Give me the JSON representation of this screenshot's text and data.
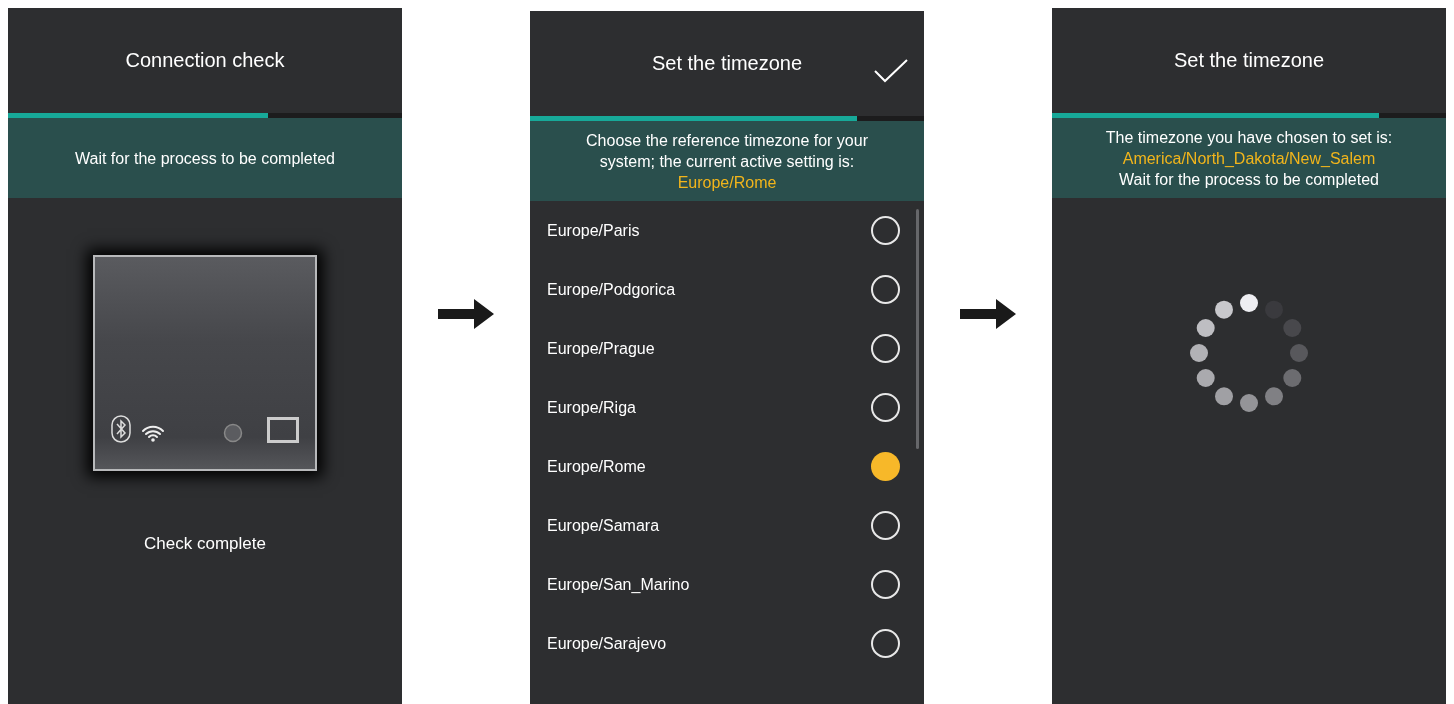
{
  "screens": [
    {
      "kind": "connection",
      "title": "Connection check",
      "confirm": false,
      "progress": {
        "level": 0.66
      },
      "banner": [
        [
          {
            "text": "Wait for the process to be completed",
            "highlight": false
          }
        ]
      ],
      "status": "Check complete"
    },
    {
      "kind": "list",
      "title": "Set the timezone",
      "confirm": true,
      "progress": {
        "level": 0.83
      },
      "banner": [
        [
          {
            "text": "Choose the reference timezone for your system; the current active setting is: ",
            "highlight": false
          },
          {
            "text": "Europe/Rome",
            "highlight": true
          }
        ]
      ],
      "timezones": [
        {
          "label": "Europe/Paris",
          "selected": false
        },
        {
          "label": "Europe/Podgorica",
          "selected": false
        },
        {
          "label": "Europe/Prague",
          "selected": false
        },
        {
          "label": "Europe/Riga",
          "selected": false
        },
        {
          "label": "Europe/Rome",
          "selected": true
        },
        {
          "label": "Europe/Samara",
          "selected": false
        },
        {
          "label": "Europe/San_Marino",
          "selected": false
        },
        {
          "label": "Europe/Sarajevo",
          "selected": false
        }
      ]
    },
    {
      "kind": "loading",
      "title": "Set the timezone",
      "confirm": false,
      "progress": {
        "level": 0.83
      },
      "banner": [
        [
          {
            "text": "The timezone you have chosen to set is:",
            "highlight": false
          }
        ],
        [
          {
            "text": "America/North_Dakota/New_Salem",
            "highlight": true
          }
        ],
        [
          {
            "text": "Wait for the process to be completed",
            "highlight": false
          }
        ]
      ]
    }
  ]
}
